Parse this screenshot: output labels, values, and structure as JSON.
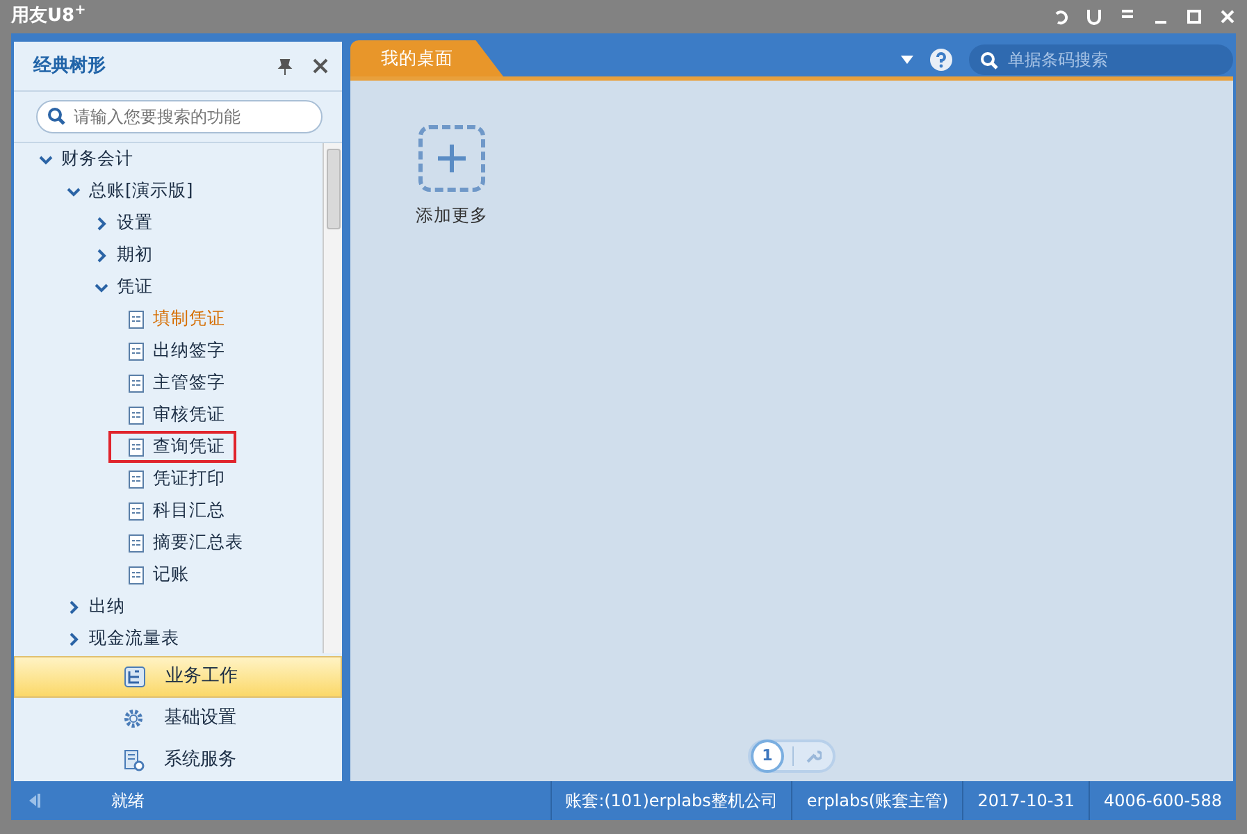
{
  "window": {
    "title": "用友U8",
    "title_sup": "+"
  },
  "sidebar": {
    "title": "经典树形",
    "search": {
      "placeholder": "请输入您要搜索的功能"
    },
    "tree": [
      {
        "label": "财务会计",
        "expanded": true,
        "children": [
          {
            "label": "总账[演示版]",
            "expanded": true,
            "children": [
              {
                "label": "设置",
                "expanded": false
              },
              {
                "label": "期初",
                "expanded": false
              },
              {
                "label": "凭证",
                "expanded": true,
                "children": [
                  {
                    "label": "填制凭证",
                    "kind": "leaf",
                    "selected": true,
                    "highlighted": false
                  },
                  {
                    "label": "出纳签字",
                    "kind": "leaf",
                    "selected": false,
                    "highlighted": false
                  },
                  {
                    "label": "主管签字",
                    "kind": "leaf",
                    "selected": false,
                    "highlighted": false
                  },
                  {
                    "label": "审核凭证",
                    "kind": "leaf",
                    "selected": false,
                    "highlighted": false
                  },
                  {
                    "label": "查询凭证",
                    "kind": "leaf",
                    "selected": false,
                    "highlighted": true
                  },
                  {
                    "label": "凭证打印",
                    "kind": "leaf",
                    "selected": false,
                    "highlighted": false
                  },
                  {
                    "label": "科目汇总",
                    "kind": "leaf",
                    "selected": false,
                    "highlighted": false
                  },
                  {
                    "label": "摘要汇总表",
                    "kind": "leaf",
                    "selected": false,
                    "highlighted": false
                  },
                  {
                    "label": "记账",
                    "kind": "leaf",
                    "selected": false,
                    "highlighted": false
                  }
                ]
              }
            ]
          },
          {
            "label": "出纳",
            "expanded": false
          },
          {
            "label": "现金流量表",
            "expanded": false
          }
        ]
      }
    ],
    "nav": [
      {
        "label": "业务工作",
        "kind": "tree",
        "selected": true
      },
      {
        "label": "基础设置",
        "kind": "gear",
        "selected": false
      },
      {
        "label": "系统服务",
        "kind": "server",
        "selected": false
      }
    ]
  },
  "tabs": [
    {
      "label": "我的桌面",
      "selected": true
    }
  ],
  "top_search": {
    "placeholder": "单据条码搜索"
  },
  "desktop": {
    "add_label": "添加更多",
    "pager": [
      {
        "label": "1",
        "selected": true
      }
    ]
  },
  "status_bar": {
    "status": "就绪",
    "fields": [
      "账套:(101)erplabs整机公司",
      "erplabs(账套主管)",
      "2017-10-31",
      "4006-600-588"
    ]
  }
}
